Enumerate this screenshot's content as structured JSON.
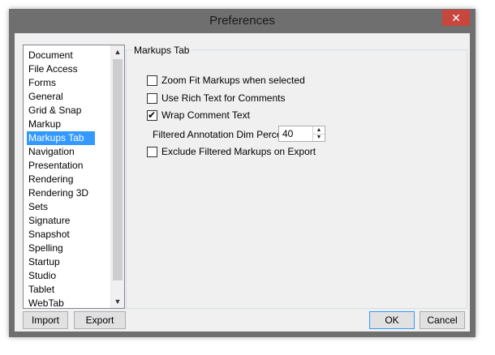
{
  "window": {
    "title": "Preferences",
    "close_symbol": "✕"
  },
  "sidebar": {
    "items": [
      {
        "label": "Document"
      },
      {
        "label": "File Access"
      },
      {
        "label": "Forms"
      },
      {
        "label": "General"
      },
      {
        "label": "Grid & Snap"
      },
      {
        "label": "Markup"
      },
      {
        "label": "Markups Tab",
        "selected": true
      },
      {
        "label": "Navigation"
      },
      {
        "label": "Presentation"
      },
      {
        "label": "Rendering"
      },
      {
        "label": "Rendering 3D"
      },
      {
        "label": "Sets"
      },
      {
        "label": "Signature"
      },
      {
        "label": "Snapshot"
      },
      {
        "label": "Spelling"
      },
      {
        "label": "Startup"
      },
      {
        "label": "Studio"
      },
      {
        "label": "Tablet"
      },
      {
        "label": "WebTab"
      }
    ],
    "scroll_up": "▲",
    "scroll_down": "▼"
  },
  "panel": {
    "title": "Markups Tab",
    "options": [
      {
        "label": "Zoom Fit Markups when selected",
        "checked": false
      },
      {
        "label": "Use Rich Text for Comments",
        "checked": false
      },
      {
        "label": "Wrap Comment Text",
        "checked": true
      }
    ],
    "dim_percent": {
      "label": "Filtered Annotation Dim Percent:",
      "value": "40",
      "up": "▲",
      "down": "▼"
    },
    "exclude_option": {
      "label": "Exclude Filtered Markups on Export",
      "checked": false
    }
  },
  "buttons": {
    "import": "Import",
    "export": "Export",
    "ok": "OK",
    "cancel": "Cancel"
  }
}
